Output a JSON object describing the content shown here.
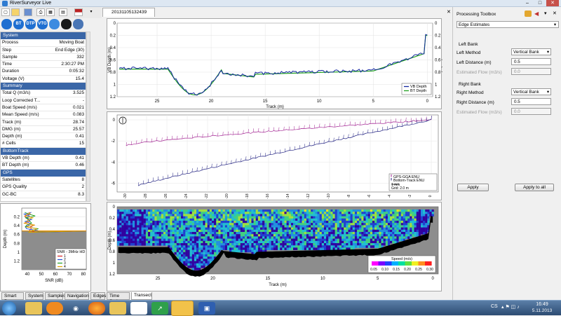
{
  "window": {
    "title": "RiverSurveyor Live"
  },
  "document_tab": "20131105132439",
  "toolbar_icons": [
    "new-file-icon",
    "open-folder-icon",
    "save-icon",
    "print-icon",
    "grid-icon",
    "language-flag-icon",
    "layout-icon"
  ],
  "mode_icons": [
    {
      "name": "bluetooth-icon",
      "label": "",
      "color": "#1f6fd1"
    },
    {
      "name": "bt-icon",
      "label": "BT",
      "color": "#1f6fd1"
    },
    {
      "name": "dtp-icon",
      "label": "DTP",
      "color": "#1f6fd1"
    },
    {
      "name": "vtg-icon",
      "label": "VTG",
      "color": "#1f6fd1"
    },
    {
      "name": "map-icon",
      "label": "",
      "color": "#3c8be0"
    },
    {
      "name": "settings-wheel-icon",
      "label": "",
      "color": "#1a1a1a"
    },
    {
      "name": "cylinder-icon",
      "label": "",
      "color": "#4a76b5"
    }
  ],
  "left_table": [
    {
      "type": "header",
      "label": "System"
    },
    {
      "k": "Process",
      "v": "Moving Boat"
    },
    {
      "k": "Step",
      "v": "End Edge (30)"
    },
    {
      "k": "Sample",
      "v": "332"
    },
    {
      "k": "Time",
      "v": "2:30:27 PM"
    },
    {
      "k": "Duration",
      "v": "0:05:32"
    },
    {
      "k": "Voltage (V)",
      "v": "15.4"
    },
    {
      "type": "header",
      "label": "Summary"
    },
    {
      "k": "Total Q (m3/s)",
      "v": "3.525"
    },
    {
      "k": "Loop Corrected T...",
      "v": "-"
    },
    {
      "k": "Boat Speed (m/s)",
      "v": "0.021"
    },
    {
      "k": "Mean Speed (m/s)",
      "v": "0.083"
    },
    {
      "k": "Track (m)",
      "v": "28.74"
    },
    {
      "k": "DMG (m)",
      "v": "25.57"
    },
    {
      "k": "Depth (m)",
      "v": "0.41"
    },
    {
      "k": "# Cells",
      "v": "15"
    },
    {
      "type": "header",
      "label": "BottomTrack"
    },
    {
      "k": "VB Depth (m)",
      "v": "0.41"
    },
    {
      "k": "BT Depth (m)",
      "v": "0.46"
    },
    {
      "type": "header",
      "label": "GPS"
    },
    {
      "k": "Satellites",
      "v": "8"
    },
    {
      "k": "GPS Quality",
      "v": "2"
    },
    {
      "k": "GC-BC",
      "v": "8.3"
    }
  ],
  "snr_plot": {
    "ylabel": "Depth (m)",
    "xlabel": "SNR (dB)",
    "yticks": [
      "0.2",
      "0.4",
      "0.6",
      "0.8",
      "1",
      "1.2"
    ],
    "xticks": [
      "40",
      "50",
      "60",
      "70",
      "80"
    ],
    "legend_title": "SNR - 3MHz HD",
    "legend": [
      {
        "label": "1",
        "color": "#d62020"
      },
      {
        "label": "2",
        "color": "#2050d6"
      },
      {
        "label": "3",
        "color": "#20a020"
      },
      {
        "label": "4",
        "color": "#e0a000"
      }
    ]
  },
  "depth_plot": {
    "ylabel_left": "VB Depth (m)",
    "ylabel_right": "BT Depth (m)",
    "xlabel": "Track (m)",
    "yticks": [
      "0",
      "0.2",
      "0.4",
      "0.6",
      "0.8",
      "1",
      "1.2"
    ],
    "xticks": [
      "25",
      "20",
      "15",
      "10",
      "5",
      "0"
    ],
    "legend": [
      {
        "label": "VB Depth",
        "color": "#1428a0"
      },
      {
        "label": "BT Depth",
        "color": "#20a020"
      }
    ]
  },
  "track_plot": {
    "yticks": [
      "0",
      "-2",
      "-4",
      "-6"
    ],
    "xticks": [
      "-30",
      "-28",
      "-26",
      "-24",
      "-22",
      "-20",
      "-18",
      "-16",
      "-14",
      "-12",
      "-10",
      "-8",
      "-6",
      "-4",
      "-2",
      "0"
    ],
    "legend": [
      {
        "label": "GPS-GGA ENU",
        "color": "#a02090"
      },
      {
        "label": "Bottom-Track ENU",
        "color": "#202080"
      }
    ],
    "scale_label": "1 m/s",
    "grid_label": "Grid: 2.0 m"
  },
  "velocity_plot": {
    "ylabel": "Depth (m)",
    "xlabel": "Track (m)",
    "yticks": [
      "0",
      "0.2",
      "0.4",
      "0.6",
      "0.8",
      "1",
      "1.2"
    ],
    "xticks": [
      "25",
      "20",
      "15",
      "10",
      "5",
      "0"
    ],
    "colorbar_title": "Speed (m/s)",
    "colorbar_ticks": [
      "0.05",
      "0.10",
      "0.15",
      "0.20",
      "0.25",
      "0.30"
    ]
  },
  "bottom_tabs": [
    "Smart Page",
    "System",
    "Samples",
    "Navigation",
    "Edges",
    "Time Series",
    "Transect"
  ],
  "active_bottom_tab": "Transect",
  "toolbox": {
    "title": "Processing Toolbox",
    "dropdown": "Edge Estimates",
    "left_bank": {
      "heading": "Left Bank",
      "method_label": "Left Method",
      "method_value": "Vertical Bank",
      "distance_label": "Left Distance (m)",
      "distance_value": "0.5",
      "flow_label": "Estimated Flow (m3/s)",
      "flow_value": "0.0"
    },
    "right_bank": {
      "heading": "Right Bank",
      "method_label": "Right Method",
      "method_value": "Vertical Bank",
      "distance_label": "Right Distance (m)",
      "distance_value": "0.5",
      "flow_label": "Estimated Flow (m3/s)",
      "flow_value": "0.0"
    },
    "apply": "Apply",
    "apply_all": "Apply to all"
  },
  "taskbar": {
    "apps": [
      "start-orb",
      "file-explorer-icon",
      "media-player-icon",
      "wifi-app-icon",
      "firefox-icon",
      "folder-app-icon",
      "clipboard-icon",
      "powerpoint-icon",
      "green-chart-app-icon",
      "riversurveyor-app-icon",
      "floppy-save-app-icon"
    ],
    "lang": "CS",
    "time": "16:49",
    "date": "5.11.2013"
  }
}
